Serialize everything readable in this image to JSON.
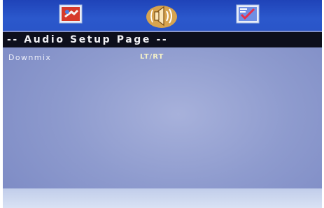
{
  "menu": {
    "icons": [
      {
        "name": "general-setup-icon"
      },
      {
        "name": "audio-speaker-icon",
        "selected": true
      },
      {
        "name": "preferences-icon"
      }
    ]
  },
  "page": {
    "title": "-- Audio Setup Page --"
  },
  "settings": [
    {
      "label": "Downmix",
      "value": "LT/RT"
    }
  ],
  "colors": {
    "topbar": "#2a55c8",
    "titlebar": "#0d0f1c",
    "background": "#8e9bce",
    "value_text": "#f4f1c8"
  }
}
